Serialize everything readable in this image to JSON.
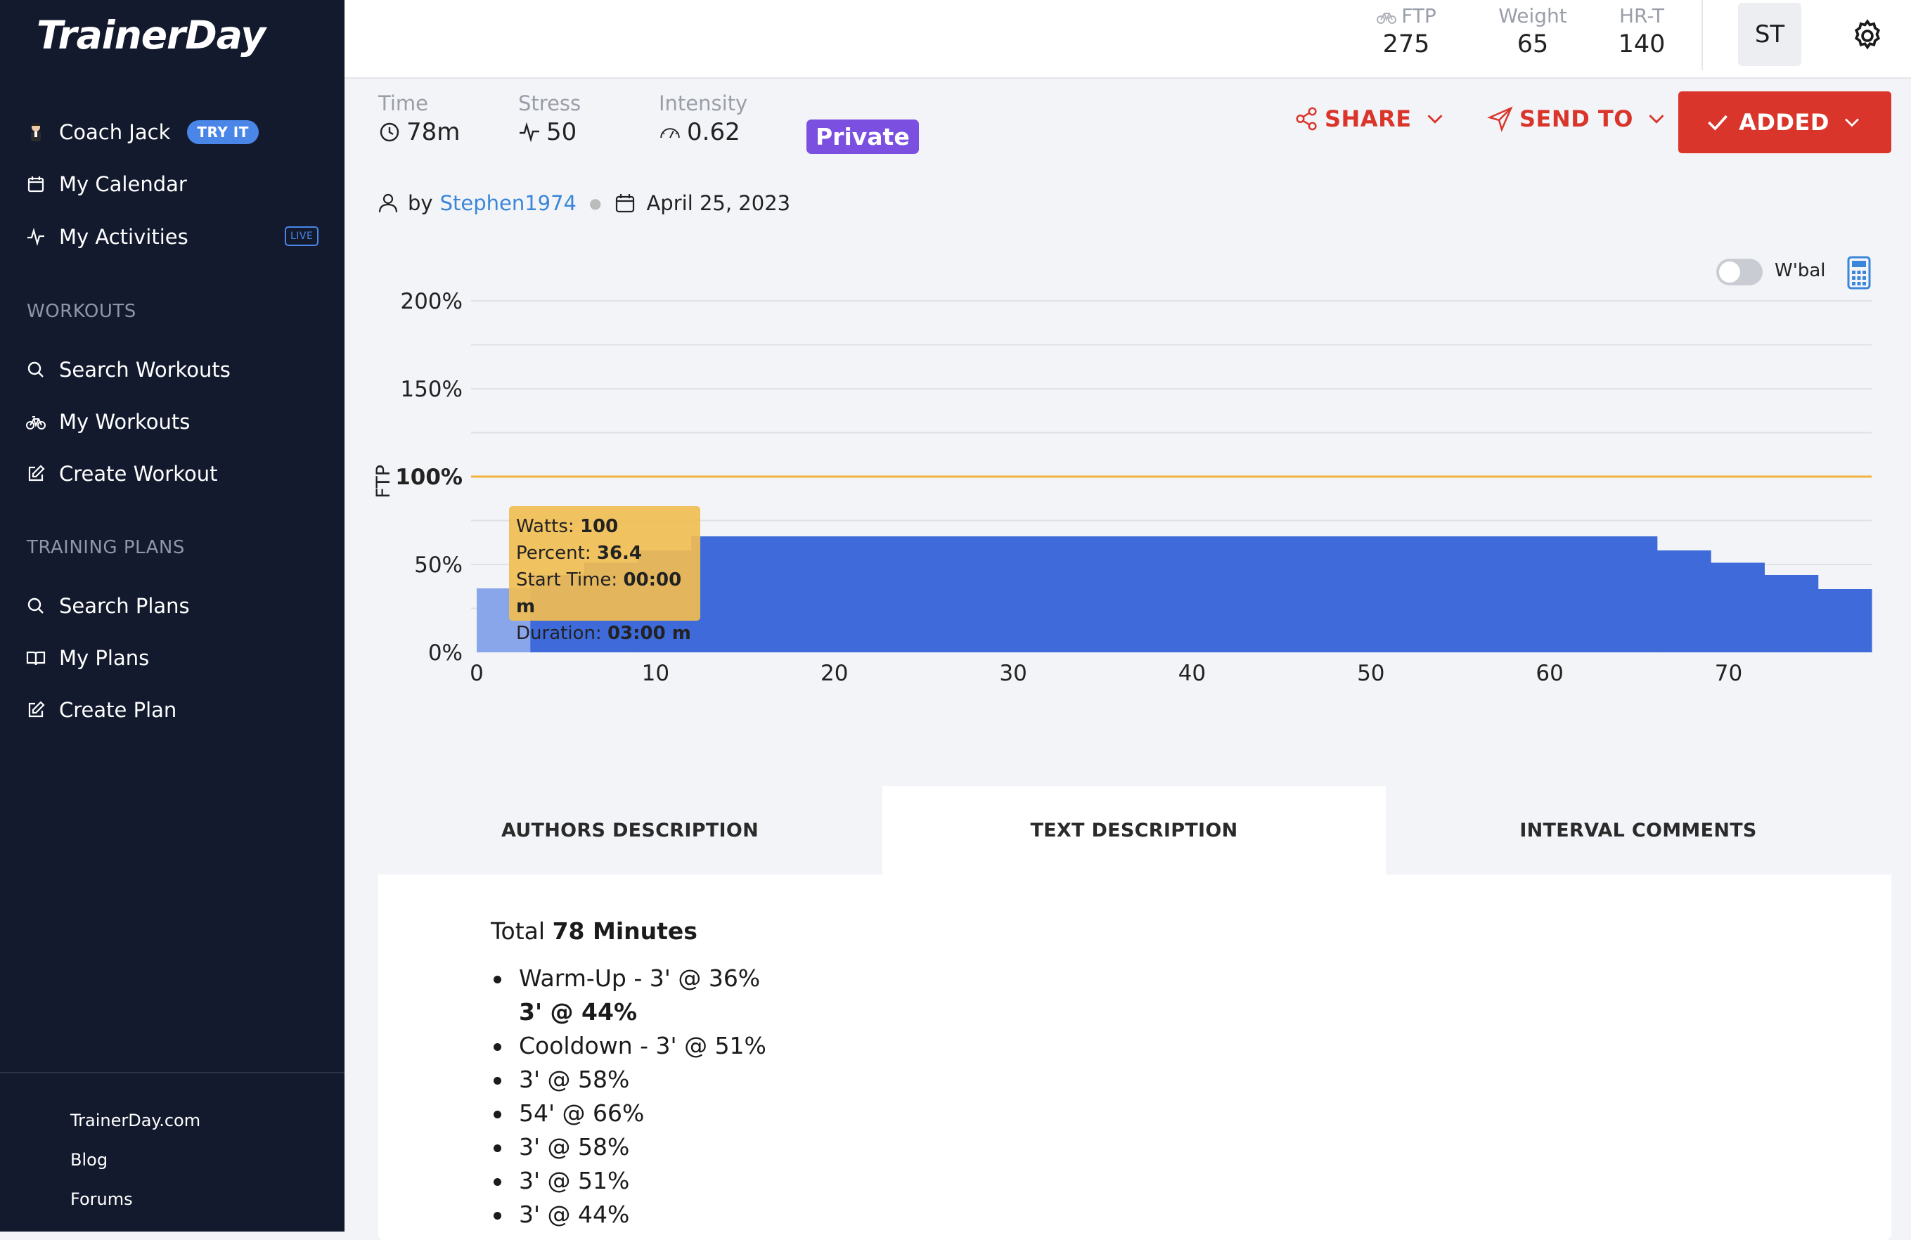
{
  "app": {
    "name": "TrainerDay"
  },
  "sidebar": {
    "coach": {
      "label": "Coach Jack",
      "badge": "TRY IT"
    },
    "top_items": [
      {
        "label": "My Calendar",
        "icon": "calendar-icon"
      },
      {
        "label": "My Activities",
        "icon": "activity-icon",
        "badge": "LIVE"
      }
    ],
    "workouts_section": {
      "title": "WORKOUTS",
      "items": [
        {
          "label": "Search Workouts",
          "icon": "search-icon"
        },
        {
          "label": "My Workouts",
          "icon": "bike-icon"
        },
        {
          "label": "Create Workout",
          "icon": "edit-icon"
        }
      ]
    },
    "plans_section": {
      "title": "TRAINING PLANS",
      "items": [
        {
          "label": "Search Plans",
          "icon": "search-icon"
        },
        {
          "label": "My Plans",
          "icon": "book-icon"
        },
        {
          "label": "Create Plan",
          "icon": "edit-icon"
        }
      ]
    },
    "footer_links": [
      "TrainerDay.com",
      "Blog",
      "Forums"
    ]
  },
  "header": {
    "ftp": {
      "label": "FTP",
      "value": "275",
      "icon": "bike-icon"
    },
    "weight": {
      "label": "Weight",
      "value": "65"
    },
    "hrt": {
      "label": "HR-T",
      "value": "140"
    },
    "avatar": "ST",
    "settings_icon": "gear-icon"
  },
  "workout": {
    "time": {
      "label": "Time",
      "value": "78m",
      "icon": "clock-icon"
    },
    "stress": {
      "label": "Stress",
      "value": "50",
      "icon": "pulse-icon"
    },
    "intensity": {
      "label": "Intensity",
      "value": "0.62",
      "icon": "gauge-icon"
    },
    "visibility": "Private",
    "share_label": "SHARE",
    "send_label": "SEND TO",
    "added_label": "ADDED",
    "author_prefix": "by",
    "author": "Stephen1974",
    "date": "April 25, 2023"
  },
  "chart_controls": {
    "wbal_label": "W'bal",
    "wbal_on": false
  },
  "chart_data": {
    "type": "area",
    "ylabel": "FTP",
    "yticks": [
      "0%",
      "50%",
      "100%",
      "150%",
      "200%"
    ],
    "ylim": [
      0,
      200
    ],
    "xticks": [
      "0",
      "10",
      "20",
      "30",
      "40",
      "50",
      "60",
      "70"
    ],
    "xlim": [
      0,
      78
    ],
    "ftp_line": 100,
    "series": [
      {
        "segments": [
          {
            "start": 0,
            "duration": 3,
            "percent": 36.4
          },
          {
            "start": 3,
            "duration": 3,
            "percent": 44
          },
          {
            "start": 6,
            "duration": 3,
            "percent": 51
          },
          {
            "start": 9,
            "duration": 3,
            "percent": 58
          },
          {
            "start": 12,
            "duration": 54,
            "percent": 66
          },
          {
            "start": 66,
            "duration": 3,
            "percent": 58
          },
          {
            "start": 69,
            "duration": 3,
            "percent": 51
          },
          {
            "start": 72,
            "duration": 3,
            "percent": 44
          },
          {
            "start": 75,
            "duration": 3,
            "percent": 36
          }
        ]
      }
    ],
    "colors": {
      "bars": "#3e6bd9",
      "highlight": "#8aa6ea",
      "ftp_line": "#f2b23b",
      "grid": "#dfe1e6"
    },
    "tooltip": {
      "watts_label": "Watts:",
      "watts": "100",
      "percent_label": "Percent:",
      "percent": "36.4",
      "start_label": "Start Time:",
      "start": "00:00 m",
      "duration_label": "Duration:",
      "duration": "03:00 m"
    }
  },
  "tabs": [
    {
      "label": "AUTHORS DESCRIPTION",
      "active": false
    },
    {
      "label": "TEXT DESCRIPTION",
      "active": true
    },
    {
      "label": "INTERVAL COMMENTS",
      "active": false
    }
  ],
  "description": {
    "total_prefix": "Total",
    "total_value": "78 Minutes",
    "items": [
      {
        "text": "Warm-Up - 3' @ 36%",
        "bullet": true,
        "bold": false
      },
      {
        "text": "3' @ 44%",
        "bullet": false,
        "bold": true
      },
      {
        "text": "Cooldown - 3' @ 51%",
        "bullet": true,
        "bold": false
      },
      {
        "text": "3' @ 58%",
        "bullet": true,
        "bold": false
      },
      {
        "text": "54' @ 66%",
        "bullet": true,
        "bold": false
      },
      {
        "text": "3' @ 58%",
        "bullet": true,
        "bold": false
      },
      {
        "text": "3' @ 51%",
        "bullet": true,
        "bold": false
      },
      {
        "text": "3' @ 44%",
        "bullet": true,
        "bold": false
      }
    ]
  }
}
